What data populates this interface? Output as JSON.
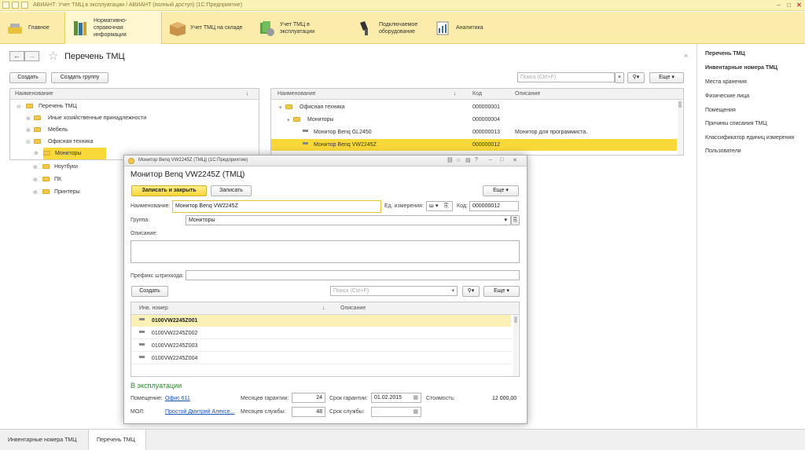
{
  "app": {
    "window_title": "АВИАНТ: Учет ТМЦ в эксплуатации / АВИАНТ (полный доступ) (1С:Предприятие)"
  },
  "sections": [
    {
      "label": "Главное",
      "icon": "home-icon"
    },
    {
      "label": "Нормативно-справочная информация",
      "icon": "books-icon"
    },
    {
      "label": "Учет ТМЦ на складе",
      "icon": "box-icon"
    },
    {
      "label": "Учет ТМЦ в эксплуатации",
      "icon": "money-icon"
    },
    {
      "label": "Подключаемое оборудование",
      "icon": "scanner-icon"
    },
    {
      "label": "Аналитика",
      "icon": "chart-icon"
    }
  ],
  "page": {
    "title": "Перечень ТМЦ",
    "create_label": "Создать",
    "create_group_label": "Создать группу",
    "search_placeholder": "Поиск (Ctrl+F)",
    "more_label": "Еще"
  },
  "left_tree": {
    "header": "Наименование",
    "items": [
      {
        "label": "Перечень ТМЦ",
        "level": 0
      },
      {
        "label": "Иные хозяйственные принадлежности",
        "level": 1
      },
      {
        "label": "Мебель",
        "level": 1
      },
      {
        "label": "Офисная техника",
        "level": 1
      },
      {
        "label": "Мониторы",
        "level": 2
      },
      {
        "label": "Ноутбуки",
        "level": 2
      },
      {
        "label": "ПК",
        "level": 2
      },
      {
        "label": "Принтеры",
        "level": 2
      }
    ]
  },
  "right_list": {
    "headers": {
      "name": "Наименование",
      "code": "Код",
      "desc": "Описание"
    },
    "rows": [
      {
        "name": "Офисная техника",
        "code": "000000001",
        "desc": ""
      },
      {
        "name": "Мониторы",
        "code": "000000004",
        "desc": ""
      },
      {
        "name": "Монитор Benq GL2450",
        "code": "000000013",
        "desc": "Монитор для программиста."
      },
      {
        "name": "Монитор Benq VW2245Z",
        "code": "000000012",
        "desc": ""
      }
    ]
  },
  "right_panel": {
    "items": [
      "Перечень ТМЦ",
      "Инвентарные номера ТМЦ",
      "Места хранения",
      "Физические лица",
      "Помещения",
      "Причины списания ТМЦ",
      "Классификатор единиц измерения",
      "Пользователи"
    ]
  },
  "modal": {
    "window_title": "Монитор Benq VW2245Z (ТМЦ) (1С:Предприятие)",
    "heading": "Монитор Benq VW2245Z (ТМЦ)",
    "save_close_label": "Записать и закрыть",
    "save_label": "Записать",
    "more_label": "Еще",
    "name_label": "Наименование:",
    "name_value": "Монитор Benq VW2245Z",
    "unit_label": "Ед. измерения:",
    "unit_value": "ш",
    "code_label": "Код:",
    "code_value": "000000012",
    "group_label": "Группа:",
    "group_value": "Мониторы",
    "desc_label": "Описание:",
    "barcode_label": "Префикс штрихкода:",
    "create_label": "Создать",
    "search_placeholder": "Поиск (Ctrl+F)",
    "table": {
      "headers": {
        "inv": "Инв. номер",
        "desc": "Описание"
      },
      "rows": [
        "0100VW2245Z001",
        "0100VW2245Z002",
        "0100VW2245Z003",
        "0100VW2245Z004"
      ]
    },
    "in_use_label": "В эксплуатации",
    "room_label": "Помещение:",
    "room_value": "Офис 611",
    "mol_label": "МОЛ:",
    "mol_value": "Простой Дмитрий Алексе...",
    "warranty_months_label": "Месяцев гарантии:",
    "warranty_months_value": "24",
    "service_months_label": "Месяцев службы:",
    "service_months_value": "48",
    "warranty_date_label": "Срок гарантии:",
    "warranty_date_value": "01.02.2015",
    "service_date_label": "Срок службы:",
    "service_date_value": ". .",
    "cost_label": "Стоимость:",
    "cost_value": "12 000,00"
  },
  "bottom_tabs": [
    {
      "label": "Инвентарные номера ТМЦ",
      "active": false
    },
    {
      "label": "Перечень ТМЦ",
      "active": true
    }
  ],
  "colors": {
    "accent": "#f9d93a",
    "sections_bg": "#fcecab",
    "link": "#1a55b8",
    "green": "#2c8a2c"
  }
}
